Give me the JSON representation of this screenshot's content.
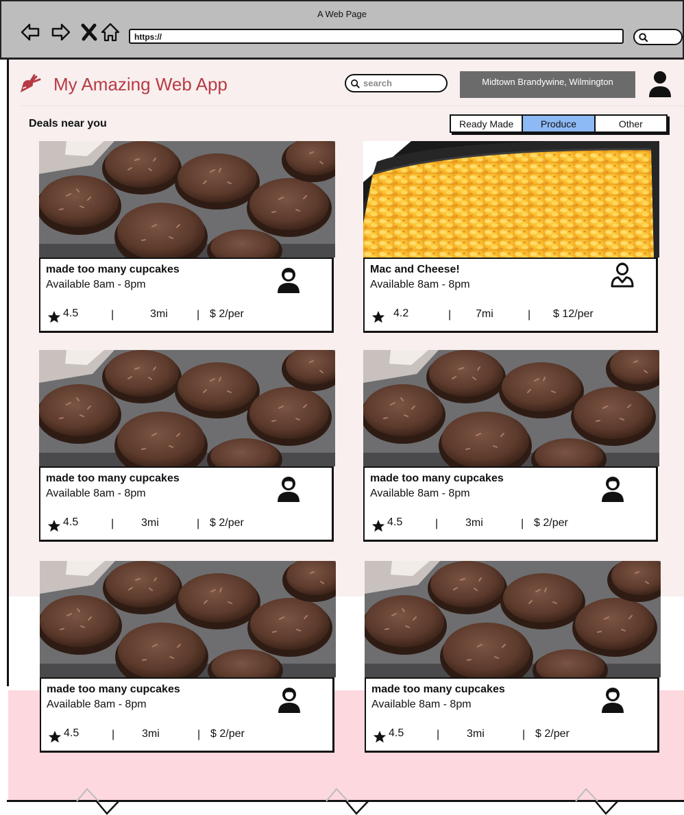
{
  "browser": {
    "window_title": "A Web Page",
    "address": "https://"
  },
  "app": {
    "title": "My Amazing Web App",
    "search_placeholder": "search",
    "location": "Midtown Brandywine, Wilmington"
  },
  "deals": {
    "heading": "Deals near you",
    "tabs": [
      {
        "label": "Ready Made",
        "active": false
      },
      {
        "label": "Produce",
        "active": true
      },
      {
        "label": "Other",
        "active": false
      }
    ],
    "listings": [
      {
        "title": "made too many cupcakes",
        "hours": "Available 8am - 8pm",
        "rating": "4.5",
        "distance": "3mi",
        "price": "$ 2/per",
        "image": "cupcakes-photo",
        "seller_icon": "woman-user-icon"
      },
      {
        "title": "Mac and Cheese!",
        "hours": "Available 8am - 8pm",
        "rating": "4.2",
        "distance": "7mi",
        "price": "$ 12/per",
        "image": "mac-and-cheese-photo",
        "seller_icon": "man-user-outline-icon"
      },
      {
        "title": "made too many cupcakes",
        "hours": "Available 8am - 8pm",
        "rating": "4.5",
        "distance": "3mi",
        "price": "$ 2/per",
        "image": "cupcakes-photo",
        "seller_icon": "woman-user-icon"
      },
      {
        "title": "made too many cupcakes",
        "hours": "Available 8am - 8pm",
        "rating": "4.5",
        "distance": "3mi",
        "price": "$ 2/per",
        "image": "cupcakes-photo",
        "seller_icon": "woman-user-icon"
      },
      {
        "title": "made too many cupcakes",
        "hours": "Available 8am - 8pm",
        "rating": "4.5",
        "distance": "3mi",
        "price": "$ 2/per",
        "image": "cupcakes-photo",
        "seller_icon": "woman-user-icon"
      },
      {
        "title": "made too many cupcakes",
        "hours": "Available 8am - 8pm",
        "rating": "4.5",
        "distance": "3mi",
        "price": "$ 2/per",
        "image": "cupcakes-photo",
        "seller_icon": "woman-user-icon"
      }
    ],
    "separator": "|"
  },
  "colors": {
    "brand": "#b73b45",
    "active_tab": "#8db9f5",
    "page_background": "#f8efee",
    "footer_background": "#fdd8de",
    "location_box": "#6b6b6b"
  }
}
